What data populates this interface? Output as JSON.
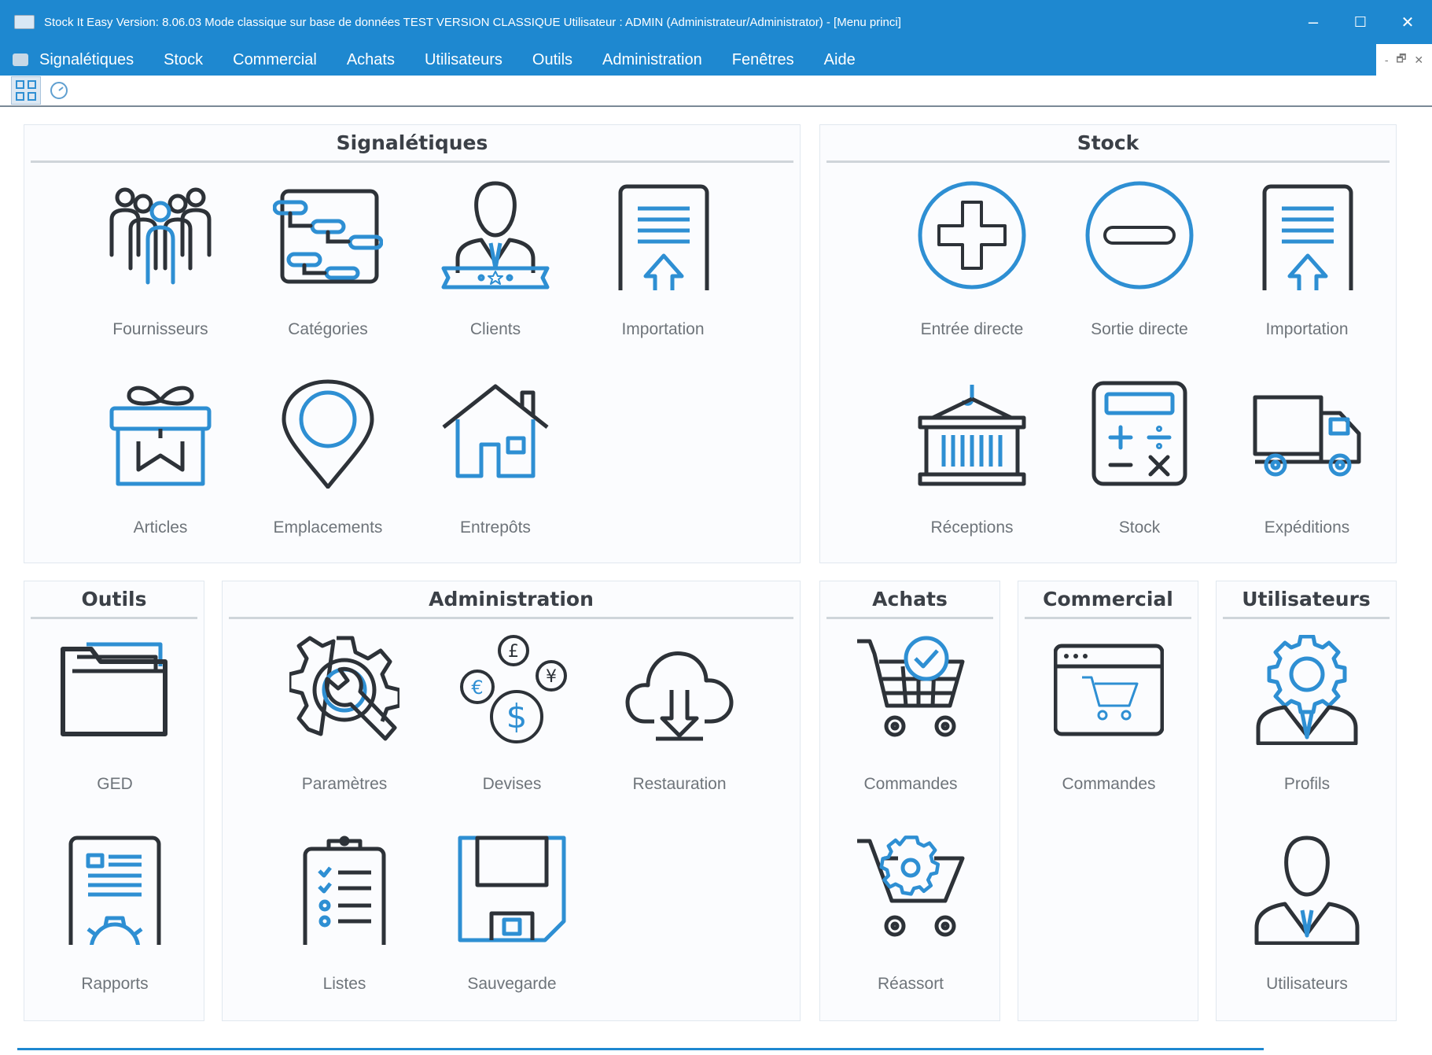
{
  "window": {
    "title": "Stock It Easy Version: 8.06.03  Mode classique sur base de données TEST VERSION CLASSIQUE Utilisateur : ADMIN (Administrateur/Administrator) - [Menu princi]",
    "controls": {
      "minimize": "–",
      "maximize": "☐",
      "close": "✕"
    }
  },
  "menubar": {
    "items": [
      "Signalétiques",
      "Stock",
      "Commercial",
      "Achats",
      "Utilisateurs",
      "Outils",
      "Administration",
      "Fenêtres",
      "Aide"
    ],
    "mdi_controls": [
      "-",
      "🗗",
      "✕"
    ]
  },
  "panels": {
    "signaletiques": {
      "title": "Signalétiques",
      "tiles": [
        {
          "label": "Fournisseurs",
          "icon": "suppliers-icon"
        },
        {
          "label": "Catégories",
          "icon": "categories-icon"
        },
        {
          "label": "Clients",
          "icon": "clients-icon"
        },
        {
          "label": "Importation",
          "icon": "import-icon"
        },
        {
          "label": "Articles",
          "icon": "gift-icon"
        },
        {
          "label": "Emplacements",
          "icon": "location-pin-icon"
        },
        {
          "label": "Entrepôts",
          "icon": "house-icon"
        }
      ]
    },
    "stock": {
      "title": "Stock",
      "tiles": [
        {
          "label": "Entrée directe",
          "icon": "plus-circle-icon"
        },
        {
          "label": "Sortie directe",
          "icon": "minus-circle-icon"
        },
        {
          "label": "Importation",
          "icon": "import-icon"
        },
        {
          "label": "Réceptions",
          "icon": "container-icon"
        },
        {
          "label": "Stock",
          "icon": "calculator-icon"
        },
        {
          "label": "Expéditions",
          "icon": "truck-icon"
        }
      ]
    },
    "outils": {
      "title": "Outils",
      "tiles": [
        {
          "label": "GED",
          "icon": "folder-icon"
        },
        {
          "label": "Rapports",
          "icon": "report-icon"
        }
      ]
    },
    "administration": {
      "title": "Administration",
      "tiles": [
        {
          "label": "Paramètres",
          "icon": "settings-wrench-icon"
        },
        {
          "label": "Devises",
          "icon": "currencies-icon"
        },
        {
          "label": "Restauration",
          "icon": "cloud-download-icon"
        },
        {
          "label": "Listes",
          "icon": "clipboard-list-icon"
        },
        {
          "label": "Sauvegarde",
          "icon": "floppy-disk-icon"
        }
      ]
    },
    "achats": {
      "title": "Achats",
      "tiles": [
        {
          "label": "Commandes",
          "icon": "cart-check-icon"
        },
        {
          "label": "Réassort",
          "icon": "cart-gear-icon"
        }
      ]
    },
    "commercial": {
      "title": "Commercial",
      "tiles": [
        {
          "label": "Commandes",
          "icon": "web-cart-icon"
        }
      ]
    },
    "utilisateurs": {
      "title": "Utilisateurs",
      "tiles": [
        {
          "label": "Profils",
          "icon": "profile-gear-icon"
        },
        {
          "label": "Utilisateurs",
          "icon": "user-icon"
        }
      ]
    }
  },
  "colors": {
    "accent": "#1E88D0",
    "icon_dark": "#2d3238",
    "icon_blue": "#2e8fd3"
  }
}
